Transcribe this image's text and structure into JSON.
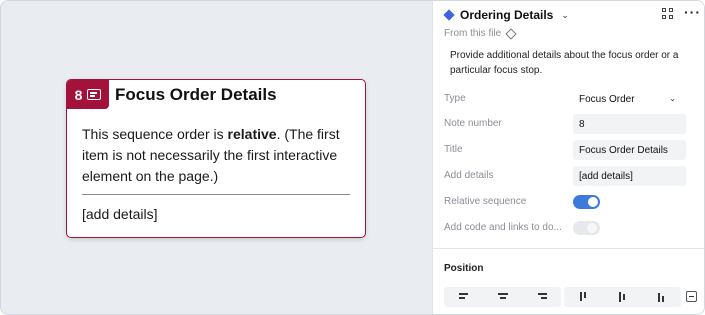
{
  "canvas": {
    "card": {
      "number": "8",
      "title": "Focus Order Details",
      "body_prefix": "This sequence order is ",
      "body_bold": "relative",
      "body_suffix": ". (The first item is not necessarily the first interactive element on the page.)",
      "footer": "[add details]",
      "accent_color": "#a3123a"
    }
  },
  "panel": {
    "title": "Ordering Details",
    "from_file": "From this file",
    "description": "Provide additional details about the focus order or a particular focus stop.",
    "fields": {
      "type": {
        "label": "Type",
        "value": "Focus Order"
      },
      "note_number": {
        "label": "Note number",
        "value": "8"
      },
      "title": {
        "label": "Title",
        "value": "Focus Order Details"
      },
      "add_details": {
        "label": "Add details",
        "value": "[add details]"
      },
      "relative_sequence": {
        "label": "Relative sequence",
        "on": true
      },
      "add_code_links": {
        "label": "Add code and links to do...",
        "on": false
      }
    },
    "position_title": "Position",
    "toggle_color": "#3d7bdb"
  }
}
